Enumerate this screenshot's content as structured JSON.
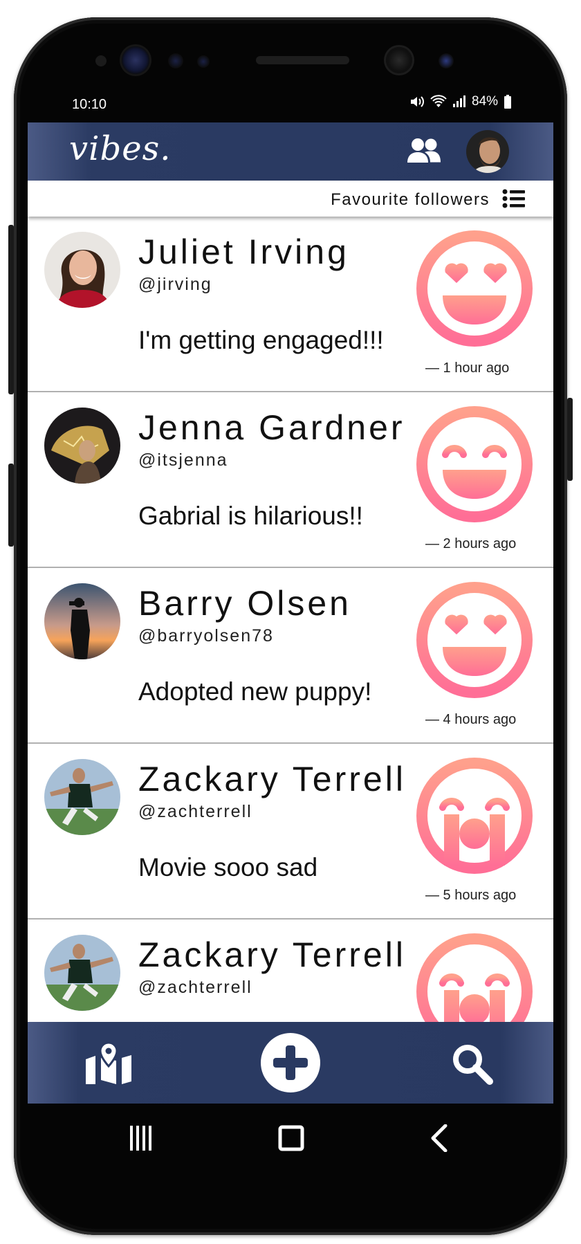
{
  "status_bar": {
    "time": "10:10",
    "battery": "84%"
  },
  "header": {
    "logo": "vibes."
  },
  "favourites": {
    "label": "Favourite followers"
  },
  "posts": [
    {
      "name": "Juliet Irving",
      "handle": "@jirving",
      "message": "I'm getting engaged!!!",
      "time": "— 1 hour ago",
      "mood": "heart-eyes"
    },
    {
      "name": "Jenna Gardner",
      "handle": "@itsjenna",
      "message": "Gabrial is hilarious!!",
      "time": "— 2 hours ago",
      "mood": "laughing"
    },
    {
      "name": "Barry Olsen",
      "handle": "@barryolsen78",
      "message": "Adopted new puppy!",
      "time": "— 4 hours ago",
      "mood": "heart-eyes"
    },
    {
      "name": "Zackary Terrell",
      "handle": "@zachterrell",
      "message": "Movie sooo sad",
      "time": "— 5 hours ago",
      "mood": "crying"
    },
    {
      "name": "Zackary Terrell",
      "handle": "@zachterrell",
      "message": "",
      "time": "",
      "mood": "crying"
    }
  ],
  "bottom_nav": {
    "items": [
      "map-icon",
      "add-icon",
      "search-icon"
    ]
  },
  "colors": {
    "brand": "#293961",
    "emoji_top": "#ff9b8a",
    "emoji_bottom": "#ff6f93"
  }
}
